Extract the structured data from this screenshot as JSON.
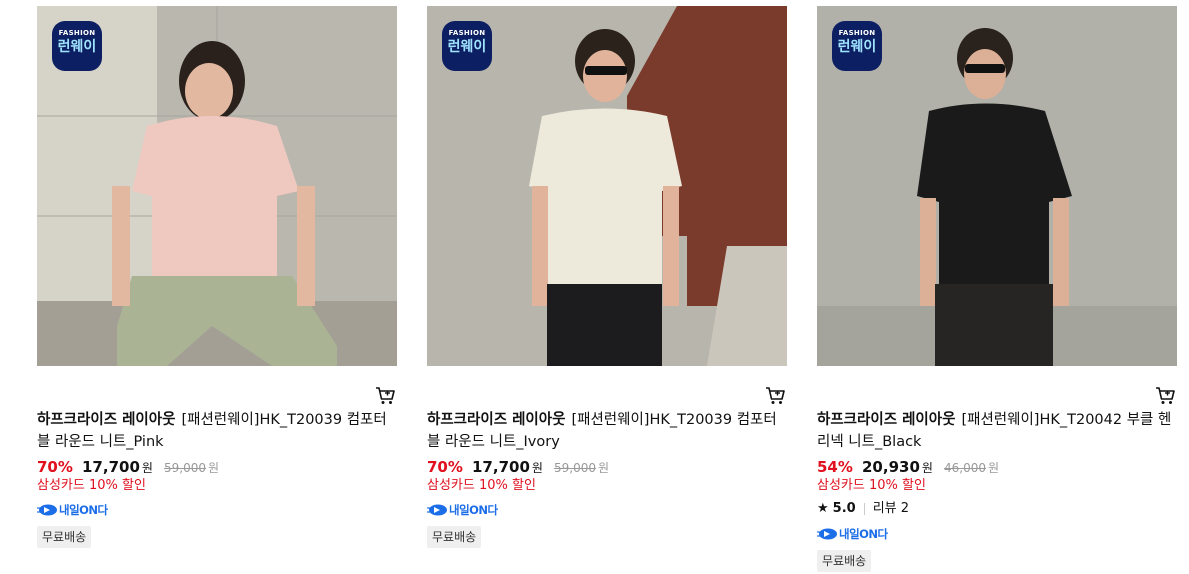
{
  "products": [
    {
      "badge": {
        "top": "FASHION",
        "main": "런웨이"
      },
      "brand": "하프크라이즈 레이아웃",
      "name": "[패션런웨이]HK_T20039 컴포터블 라운드 니트_Pink",
      "discount": "70%",
      "price": "17,700",
      "won": "원",
      "original_price": "59,000",
      "card_benefit": "삼성카드 10% 할인",
      "delivery_label": "내일ON다",
      "shipping_tag": "무료배송",
      "colors": {
        "bg": "#b9b7ae",
        "shirt": "#efc8c0",
        "pants": "#aab394",
        "hair": "#2a211c"
      }
    },
    {
      "badge": {
        "top": "FASHION",
        "main": "런웨이"
      },
      "brand": "하프크라이즈 레이아웃",
      "name": "[패션런웨이]HK_T20039 컴포터블 라운드 니트_Ivory",
      "discount": "70%",
      "price": "17,700",
      "won": "원",
      "original_price": "59,000",
      "card_benefit": "삼성카드 10% 할인",
      "delivery_label": "내일ON다",
      "shipping_tag": "무료배송",
      "colors": {
        "bg": "#b8b5ad",
        "shirt": "#eeeadb",
        "pants": "#1c1c1e",
        "accent": "#7a3a2c"
      }
    },
    {
      "badge": {
        "top": "FASHION",
        "main": "런웨이"
      },
      "brand": "하프크라이즈 레이아웃",
      "name": "[패션런웨이]HK_T20042 부클 헨리넥 니트_Black",
      "discount": "54%",
      "price": "20,930",
      "won": "원",
      "original_price": "46,000",
      "card_benefit": "삼성카드 10% 할인",
      "rating": "5.0",
      "review_label": "리뷰 2",
      "delivery_label": "내일ON다",
      "shipping_tag": "무료배송",
      "colors": {
        "bg": "#b1b1aa",
        "shirt": "#1a1a1a",
        "pants": "#262523"
      }
    }
  ],
  "icons": {
    "cart": "cart-icon",
    "star": "★",
    "delivery": "truck-icon"
  },
  "accent_colors": {
    "discount": "#e0101f",
    "delivery": "#1c6ee8",
    "badge_bg": "#0d1f63"
  }
}
